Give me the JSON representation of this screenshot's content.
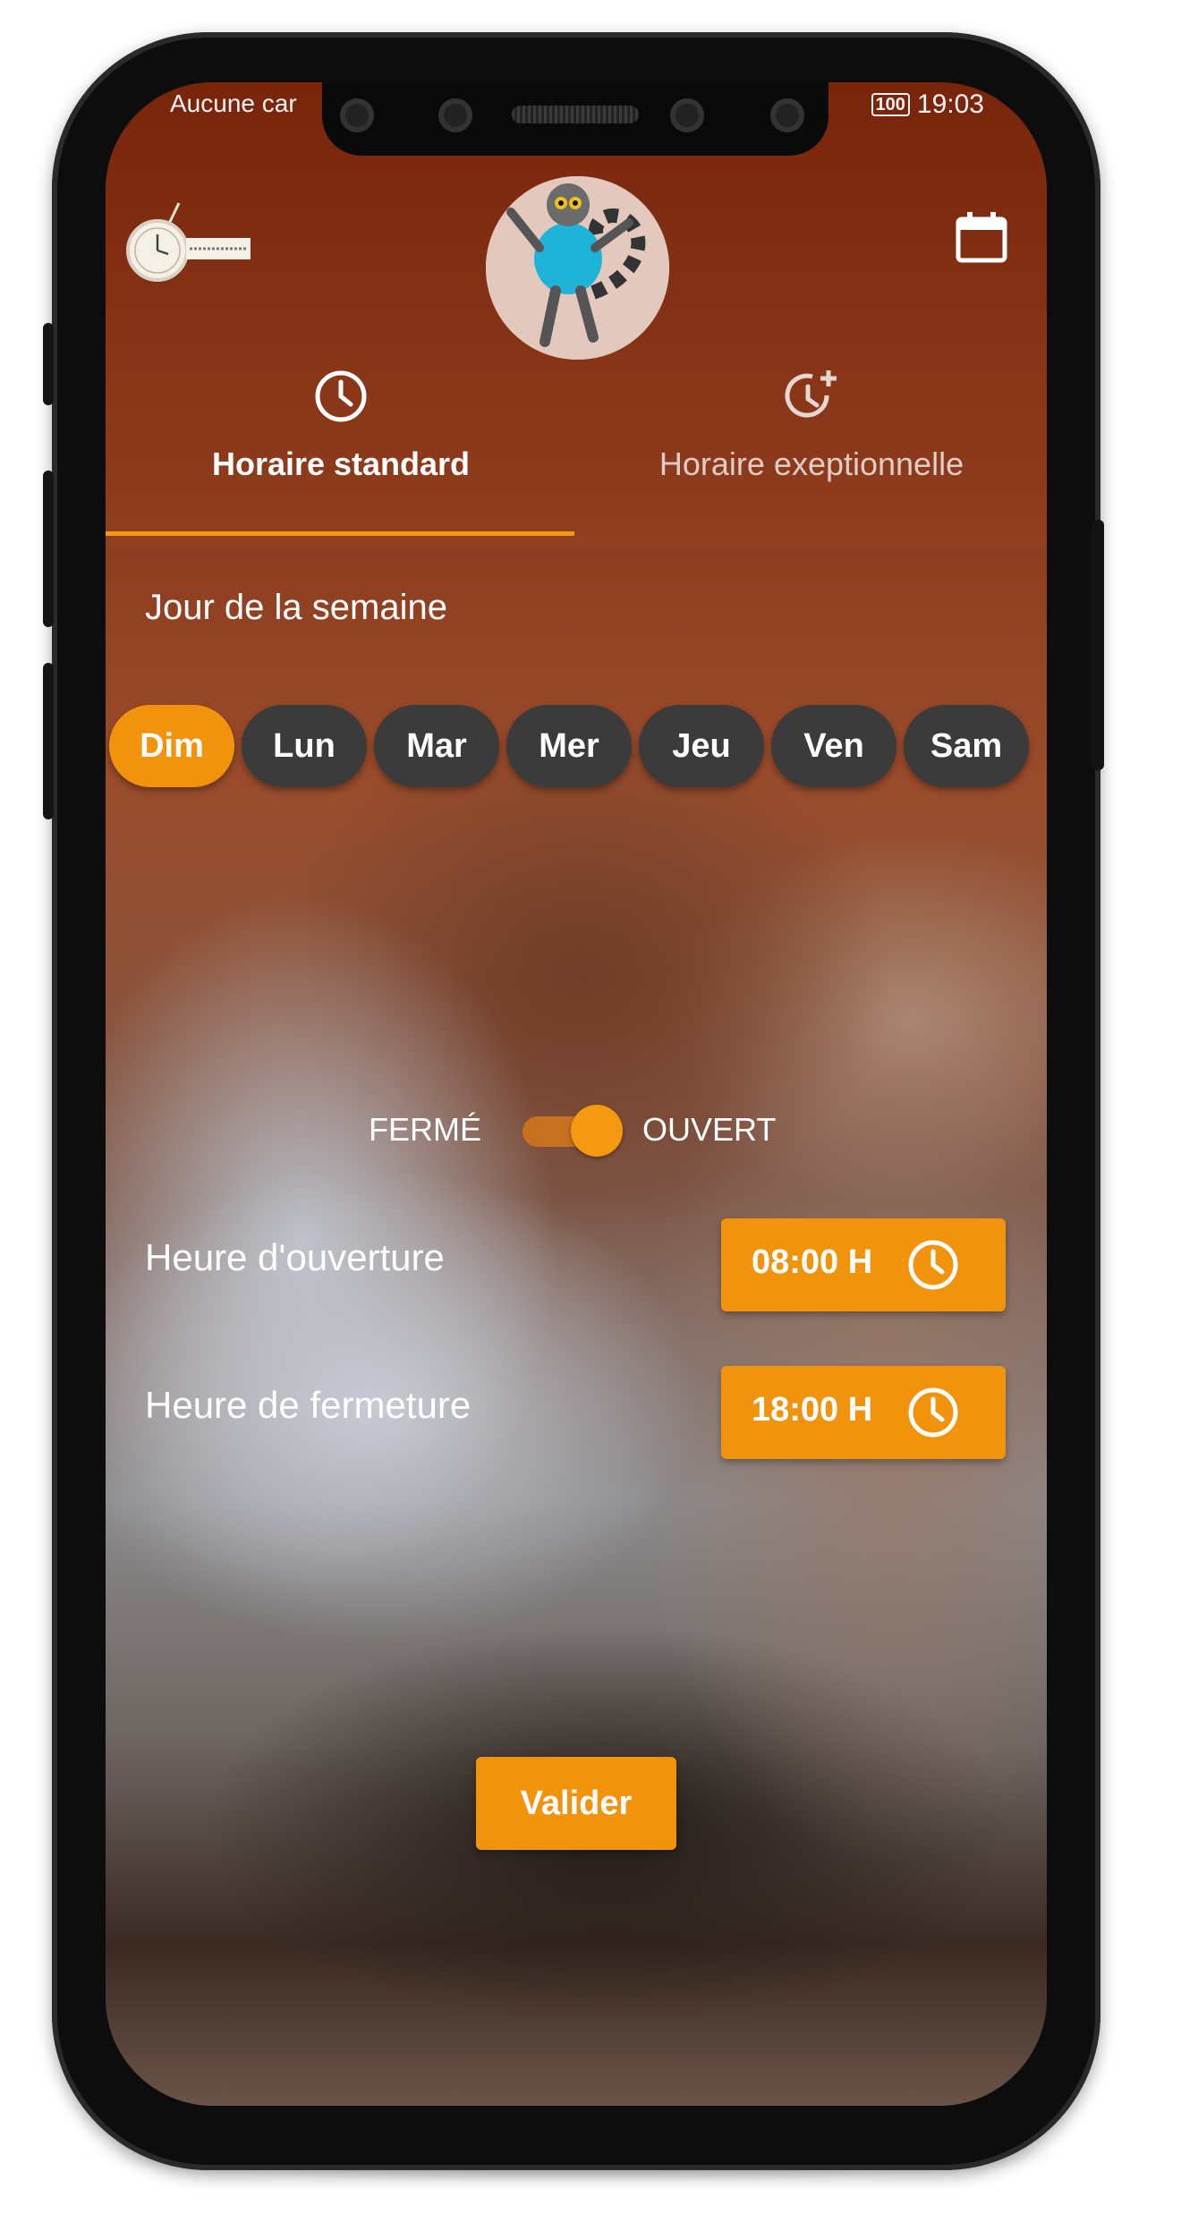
{
  "status_bar": {
    "carrier": "Aucune car",
    "battery": "100",
    "time": "19:03"
  },
  "header": {
    "logo_icon": "pocket-watch-logo",
    "avatar_icon": "lemur-avatar",
    "calendar_icon": "calendar-icon"
  },
  "tabs": [
    {
      "label": "Horaire standard",
      "icon": "clock-icon",
      "active": true
    },
    {
      "label": "Horaire exeptionnelle",
      "icon": "clock-plus-icon",
      "active": false
    }
  ],
  "section_title": "Jour de la semaine",
  "days": [
    "Dim",
    "Lun",
    "Mar",
    "Mer",
    "Jeu",
    "Ven",
    "Sam"
  ],
  "selected_day": "Dim",
  "toggle": {
    "off_label": "FERMÉ",
    "on_label": "OUVERT",
    "state": "on"
  },
  "opening": {
    "label": "Heure d'ouverture",
    "value": "08:00 H"
  },
  "closing": {
    "label": "Heure de fermeture",
    "value": "18:00 H"
  },
  "validate_label": "Valider",
  "colors": {
    "accent": "#f2930e",
    "day_chip": "#3b3b3b",
    "header": "#7a2b12"
  }
}
